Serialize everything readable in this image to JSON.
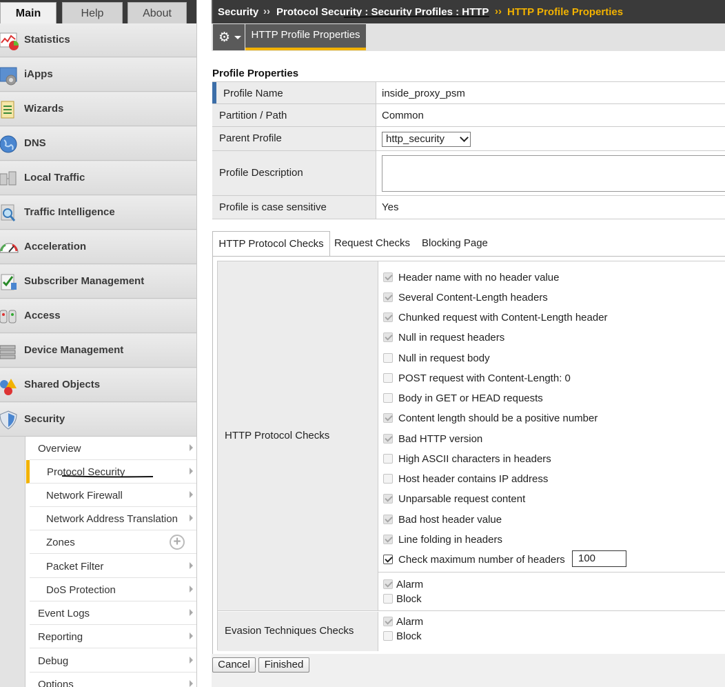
{
  "nav_tabs": {
    "main": "Main",
    "help": "Help",
    "about": "About"
  },
  "nav_items": [
    {
      "label": "Statistics",
      "icon": "statistics-icon"
    },
    {
      "label": "iApps",
      "icon": "iapps-icon"
    },
    {
      "label": "Wizards",
      "icon": "wizards-icon"
    },
    {
      "label": "DNS",
      "icon": "dns-icon"
    },
    {
      "label": "Local Traffic",
      "icon": "local-traffic-icon"
    },
    {
      "label": "Traffic Intelligence",
      "icon": "traffic-intelligence-icon"
    },
    {
      "label": "Acceleration",
      "icon": "acceleration-icon"
    },
    {
      "label": "Subscriber Management",
      "icon": "subscriber-management-icon"
    },
    {
      "label": "Access",
      "icon": "access-icon"
    },
    {
      "label": "Device Management",
      "icon": "device-management-icon"
    },
    {
      "label": "Shared Objects",
      "icon": "shared-objects-icon"
    },
    {
      "label": "Security",
      "icon": "security-shield-icon"
    }
  ],
  "security_submenu": [
    {
      "label": "Overview"
    },
    {
      "label": "Protocol Security"
    },
    {
      "label": "Network Firewall"
    },
    {
      "label": "Network Address Translation"
    },
    {
      "label": "Zones"
    },
    {
      "label": "Packet Filter"
    },
    {
      "label": "DoS Protection"
    },
    {
      "label": "Event Logs"
    },
    {
      "label": "Reporting"
    },
    {
      "label": "Debug"
    },
    {
      "label": "Options"
    }
  ],
  "breadcrumb": {
    "level1": "Security",
    "level2": "Protocol Security : Security Profiles : HTTP",
    "current": "HTTP Profile Properties",
    "separator": "››"
  },
  "toolbar": {
    "active_tab": "HTTP Profile Properties",
    "gear_icon": "gear-icon"
  },
  "profile_properties": {
    "title": "Profile Properties",
    "name_label": "Profile Name",
    "name_value": "inside_proxy_psm",
    "partition_label": "Partition / Path",
    "partition_value": "Common",
    "parent_label": "Parent Profile",
    "parent_value": "http_security",
    "description_label": "Profile Description",
    "description_value": "",
    "case_label": "Profile is case sensitive",
    "case_value": "Yes"
  },
  "check_tabs": {
    "protocol": "HTTP Protocol Checks",
    "request": "Request Checks",
    "blocking": "Blocking Page"
  },
  "protocol_checks": {
    "section_label": "HTTP Protocol Checks",
    "items": [
      {
        "label": "Header name with no header value",
        "state": "disabled-checked"
      },
      {
        "label": "Several Content-Length headers",
        "state": "disabled-checked"
      },
      {
        "label": "Chunked request with Content-Length header",
        "state": "disabled-checked"
      },
      {
        "label": "Null in request headers",
        "state": "disabled-checked"
      },
      {
        "label": "Null in request body",
        "state": "unchecked"
      },
      {
        "label": "POST request with Content-Length: 0",
        "state": "unchecked"
      },
      {
        "label": "Body in GET or HEAD requests",
        "state": "unchecked"
      },
      {
        "label": "Content length should be a positive number",
        "state": "disabled-checked"
      },
      {
        "label": "Bad HTTP version",
        "state": "disabled-checked"
      },
      {
        "label": "High ASCII characters in headers",
        "state": "unchecked"
      },
      {
        "label": "Host header contains IP address",
        "state": "unchecked"
      },
      {
        "label": "Unparsable request content",
        "state": "disabled-checked"
      },
      {
        "label": "Bad host header value",
        "state": "disabled-checked"
      },
      {
        "label": "Line folding in headers",
        "state": "disabled-checked"
      },
      {
        "label": "Check maximum number of headers",
        "state": "checked"
      }
    ],
    "max_headers_value": "100",
    "alarm_label": "Alarm",
    "block_label": "Block"
  },
  "evasion_checks": {
    "section_label": "Evasion Techniques Checks",
    "alarm_label": "Alarm",
    "block_label": "Block"
  },
  "buttons": {
    "cancel": "Cancel",
    "finished": "Finished"
  },
  "colors": {
    "accent": "#f2b200",
    "header_bg": "#3a3a3a",
    "marker": "#3c6ea8"
  }
}
